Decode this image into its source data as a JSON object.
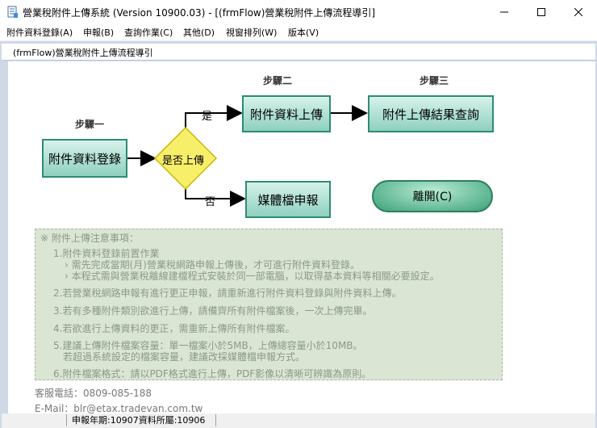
{
  "window": {
    "title": "營業稅附件上傳系統 (Version 10900.03) - [(frmFlow)營業稅附件上傳流程導引]",
    "minimize_icon": "minimize-icon",
    "maximize_icon": "maximize-icon",
    "close_icon": "close-icon"
  },
  "menu": {
    "items": [
      "附件資料登錄(A)",
      "申報(B)",
      "查詢作業(C)",
      "其他(D)",
      "視窗排列(W)",
      "版本(V)"
    ]
  },
  "child_window": {
    "title": "(frmFlow)營業稅附件上傳流程導引"
  },
  "flow": {
    "step1": "步驟一",
    "step2": "步驟二",
    "step3": "步驟三",
    "box_register": "附件資料登錄",
    "decision": "是否上傳",
    "yes_label": "是",
    "no_label": "否",
    "box_upload": "附件資料上傳",
    "box_result": "附件上傳結果查詢",
    "box_media": "媒體檔申報",
    "exit_button": "離開(C)",
    "colors": {
      "box_fill": "#b5e4d6",
      "box_border": "#2e8b75",
      "decision_fill": "#f7ee6a",
      "decision_border": "#c8b800"
    }
  },
  "notes": {
    "heading": "※ 附件上傳注意事項：",
    "n1": "1.附件資料登錄前置作業",
    "n1a": "› 需先完成當期(月)營業稅網路申報上傳後，才可進行附件資料登錄。",
    "n1b": "› 本程式需與營業稅離線建檔程式安裝於同一部電腦，以取得基本資料等相關必要設定。",
    "n2": "2.若營業稅網路申報有進行更正申報，請重新進行附件資料登錄與附件資料上傳。",
    "n3": "3.若有多種附件類別欲進行上傳，請備齊所有附件檔案後，一次上傳完畢。",
    "n4": "4.若欲進行上傳資料的更正，需重新上傳所有附件檔案。",
    "n5a": "5.建議上傳附件檔案容量：單一檔案小於5MB，上傳總容量小於10MB。",
    "n5b": "若超過系統設定的檔案容量，建議改採媒體檔申報方式。",
    "n6": "6.附件檔案格式：請以PDF格式進行上傳，PDF影像以清晰可辨識為原則。"
  },
  "contact": {
    "phone": "客服電話：0809-085-188",
    "email": "E-Mail：blr@etax.tradevan.com.tw"
  },
  "status": {
    "period": "申報年期:10907資料所屬:10906"
  }
}
